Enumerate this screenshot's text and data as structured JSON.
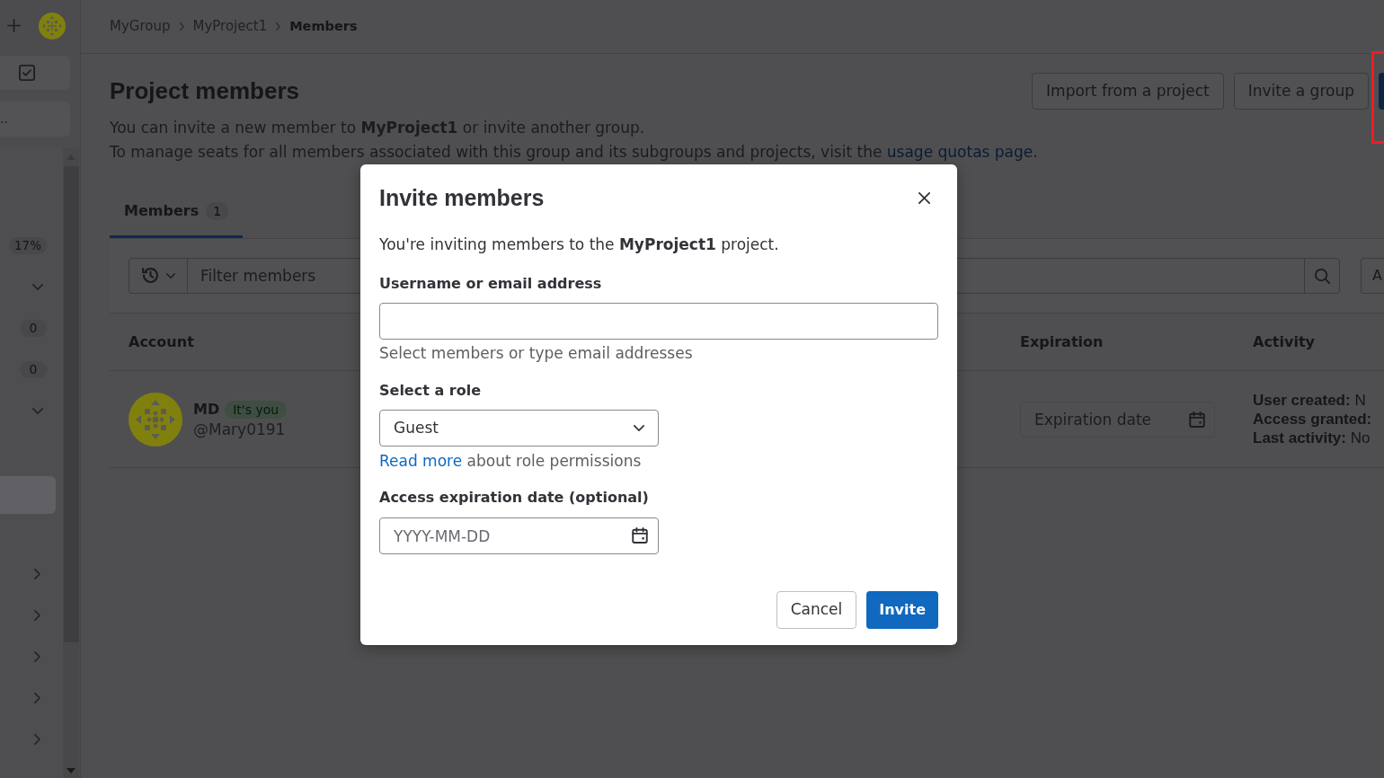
{
  "sidebar": {
    "header_items": [
      {
        "kind": "todo"
      },
      {
        "kind": "truncated",
        "text": ".."
      }
    ],
    "items": [
      {
        "kind": "percent",
        "badge": "17%"
      },
      {
        "kind": "expander",
        "expanded": true
      },
      {
        "kind": "count",
        "badge": "0"
      },
      {
        "kind": "count",
        "badge": "0"
      },
      {
        "kind": "expander",
        "expanded": true
      },
      {
        "kind": "row",
        "selected": true
      },
      {
        "kind": "expander",
        "expanded": false
      },
      {
        "kind": "expander",
        "expanded": false
      },
      {
        "kind": "expander",
        "expanded": false
      },
      {
        "kind": "expander",
        "expanded": false
      },
      {
        "kind": "expander",
        "expanded": false
      }
    ]
  },
  "breadcrumb": [
    {
      "text": "MyGroup",
      "current": false
    },
    {
      "text": "MyProject1",
      "current": false
    },
    {
      "text": "Members",
      "current": true
    }
  ],
  "header": {
    "title": "Project members",
    "actions": [
      {
        "kind": "secondary",
        "label": "Import from a project",
        "highlighted": false
      },
      {
        "kind": "secondary",
        "label": "Invite a group",
        "highlighted": false
      },
      {
        "kind": "primary",
        "highlighted": true
      }
    ],
    "intro": "You can invite a new member to **MyProject1** or invite another group.",
    "seats_note": {
      "before": "To manage seats for all members associated with this group and its subgroups and projects, visit the ",
      "link": "usage quotas page",
      "after": "."
    }
  },
  "tabs": [
    {
      "label": "Members",
      "count": "1",
      "selected": true
    }
  ],
  "filter": {
    "placeholder": "Filter members",
    "sort_label": "A"
  },
  "table": {
    "columns": [
      "Account",
      "Expiration",
      "Activity"
    ],
    "rows": [
      {
        "name": "MD",
        "badge": "It's you",
        "username": "@Mary0191",
        "expiration": {
          "placeholder": "Expiration date"
        },
        "activity": [
          "**User created:** N",
          "**Access granted:**",
          "**Last activity:** No"
        ]
      }
    ]
  },
  "dialog": {
    "title": "Invite members",
    "intro": "You're inviting members to the **MyProject1** project.",
    "username": {
      "label": "Username or email address",
      "help": "Select members or type email addresses"
    },
    "role": {
      "label": "Select a role",
      "value": "Guest",
      "help_link": "Read more",
      "help_text": " about role permissions"
    },
    "expiration": {
      "label": "Access expiration date (optional)",
      "placeholder": "YYYY-MM-DD"
    },
    "buttons": [
      {
        "kind": "secondary",
        "label": "Cancel"
      },
      {
        "kind": "primary",
        "label": "Invite"
      }
    ]
  }
}
